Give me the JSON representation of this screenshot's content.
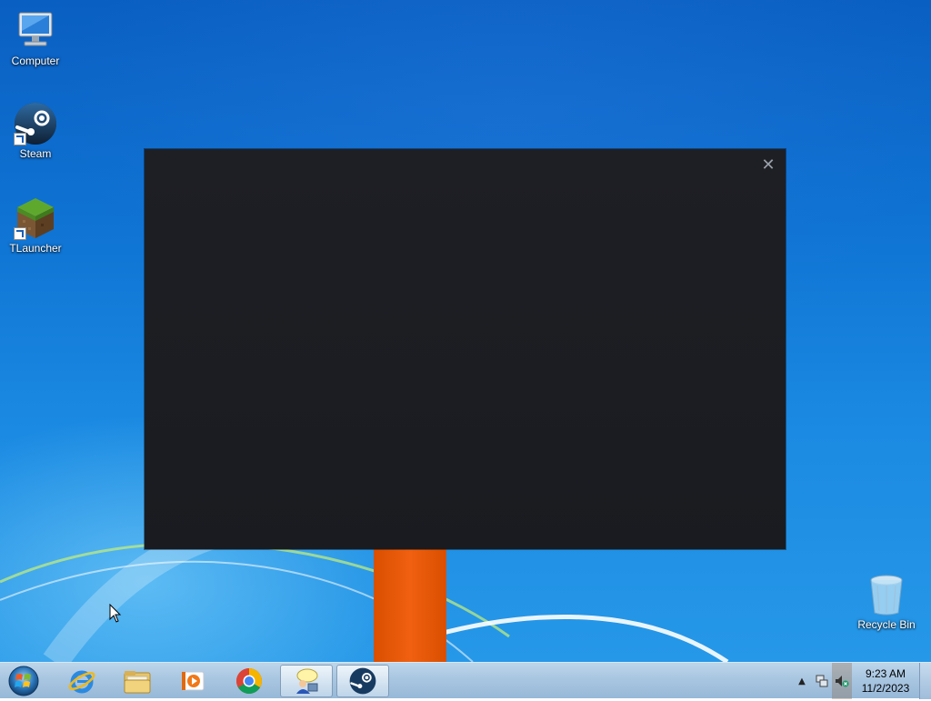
{
  "desktop": {
    "icons": [
      {
        "label": "Computer",
        "icon": "computer-icon"
      },
      {
        "label": "Steam",
        "icon": "steam-icon"
      },
      {
        "label": "TLauncher",
        "icon": "minecraft-grass-block-icon"
      },
      {
        "label": "Recycle Bin",
        "icon": "recycle-bin-icon"
      }
    ]
  },
  "window": {
    "close_glyph": "✕",
    "theme_color": "#1c1e23"
  },
  "taskbar": {
    "pinned": [
      {
        "name": "start-button",
        "icon": "windows-orb-icon"
      },
      {
        "name": "internet-explorer",
        "icon": "internet-explorer-icon"
      },
      {
        "name": "file-explorer",
        "icon": "folder-icon"
      },
      {
        "name": "media-player",
        "icon": "media-player-icon"
      },
      {
        "name": "chrome",
        "icon": "chrome-icon"
      },
      {
        "name": "app-window",
        "icon": "user-chat-icon"
      },
      {
        "name": "steam",
        "icon": "steam-icon"
      }
    ],
    "tray": {
      "show_hidden_glyph": "▲",
      "time": "9:23 AM",
      "date": "11/2/2023"
    }
  },
  "colors": {
    "accent_orange": "#e85a08",
    "desktop_blue": "#1478d4"
  }
}
